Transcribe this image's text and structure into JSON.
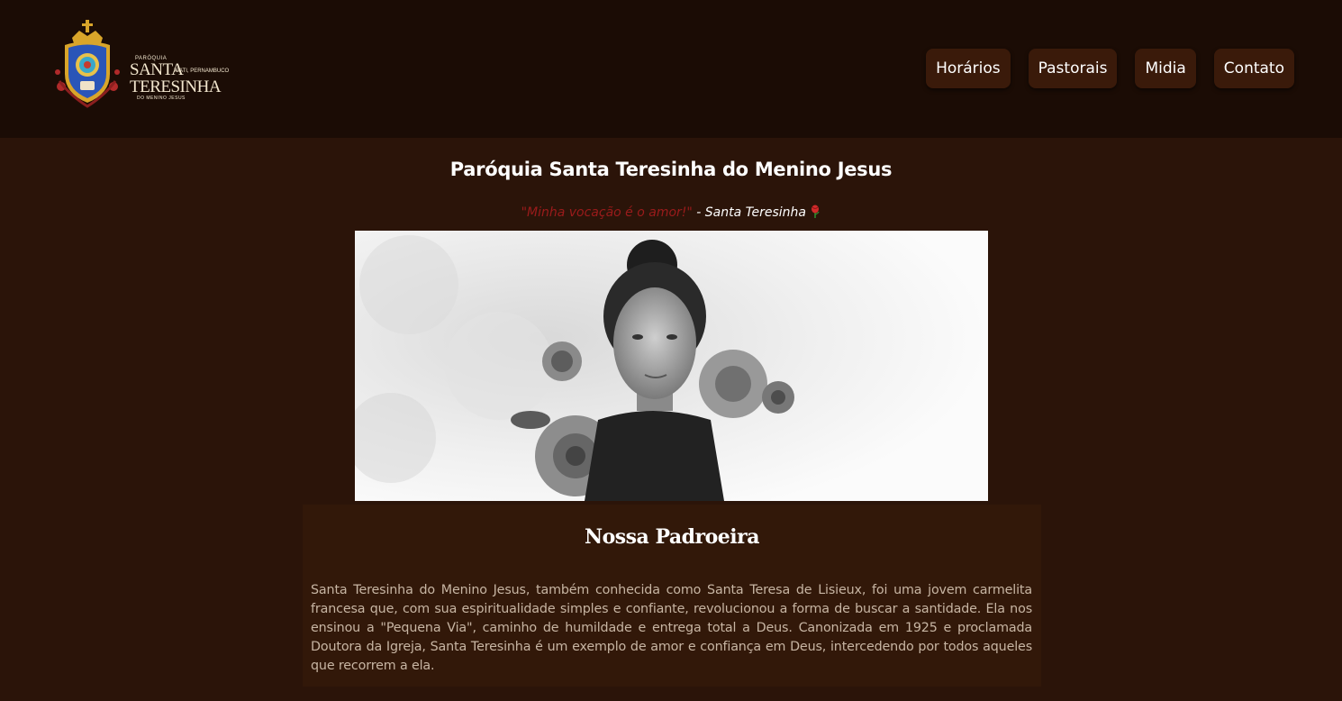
{
  "header": {
    "logo": {
      "small_top": "PARÓQUIA",
      "big_1": "SANTA",
      "location": "ICATI, PERNAMBUCO",
      "big_2": "TERESINHA",
      "small_bottom": "DO MENINO JESUS"
    },
    "nav": [
      {
        "label": "Horários"
      },
      {
        "label": "Pastorais"
      },
      {
        "label": "Midia"
      },
      {
        "label": "Contato"
      }
    ]
  },
  "main": {
    "title": "Paróquia Santa Teresinha do Menino Jesus",
    "quote_text": "\"Minha vocação é o amor!\"",
    "quote_author": " - Santa Teresinha ",
    "quote_icon": "rose-icon",
    "hero_image": "portrait-photo"
  },
  "card": {
    "title": "Nossa Padroeira",
    "text": "Santa Teresinha do Menino Jesus, também conhecida como Santa Teresa de Lisieux, foi uma jovem carmelita francesa que, com sua espiritualidade simples e confiante, revolucionou a forma de buscar a santidade. Ela nos ensinou a \"Pequena Via\", caminho de humildade e entrega total a Deus. Canonizada em 1925 e proclamada Doutora da Igreja, Santa Teresinha é um exemplo de amor e confiança em Deus, intercedendo por todos aqueles que recorrem a ela."
  },
  "colors": {
    "header_bg": "#1b0c05",
    "page_bg": "#2b1409",
    "card_bg": "#321809",
    "button_bg": "#3a1a0a",
    "quote_red": "#9b1b1b",
    "text_muted": "#c7b5a3"
  }
}
